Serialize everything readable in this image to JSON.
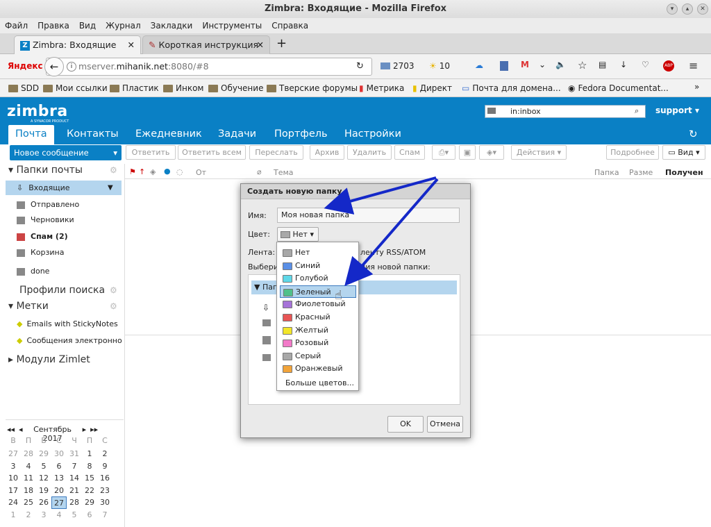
{
  "window": {
    "title": "Zimbra: Входящие - Mozilla Firefox"
  },
  "menubar": [
    "Файл",
    "Правка",
    "Вид",
    "Журнал",
    "Закладки",
    "Инструменты",
    "Справка"
  ],
  "tabs": [
    {
      "label": "Zimbra: Входящие"
    },
    {
      "label": "Короткая инструкция"
    }
  ],
  "navbar": {
    "search_engine": "Яндекс",
    "url_prefix": "mserver.",
    "url_domain": "mihanik.net",
    "url_suffix": ":8080/#8",
    "mail_count": "2703",
    "weather": "10"
  },
  "bookmarks": [
    "SDD",
    "Мои ссылки",
    "Пластик",
    "Инком",
    "Обучение",
    "Тверские форумы",
    "Метрика",
    "Директ",
    "Почта для домена...",
    "Fedora Documentat..."
  ],
  "zimbra": {
    "logo": "zimbra",
    "logo_sub": "A SYNACOR PRODUCT",
    "search_value": "in:inbox",
    "user": "support",
    "app_tabs": [
      "Почта",
      "Контакты",
      "Ежедневник",
      "Задачи",
      "Портфель",
      "Настройки"
    ],
    "new_message": "Новое сообщение",
    "toolbar": [
      "Ответить",
      "Ответить всем",
      "Переслать",
      "Архив",
      "Удалить",
      "Спам",
      "Действия",
      "Подробнее",
      "Вид"
    ],
    "list_columns": [
      "От",
      "Тема",
      "Папка",
      "Разме",
      "Получен"
    ]
  },
  "sidebar": {
    "mail_folders_title": "Папки почты",
    "folders": [
      {
        "label": "Входящие"
      },
      {
        "label": "Отправлено"
      },
      {
        "label": "Черновики"
      },
      {
        "label": "Спам (2)"
      },
      {
        "label": "Корзина"
      },
      {
        "label": "done"
      }
    ],
    "search_profiles": "Профили поиска",
    "tags_title": "Метки",
    "tags": [
      "Emails with StickyNotes",
      "Сообщения электронно"
    ],
    "zimlets": "Модули Zimlet"
  },
  "calendar": {
    "month": "Сентябрь 2017",
    "weekdays": [
      "В",
      "П",
      "В",
      "С",
      "Ч",
      "П",
      "С"
    ],
    "weeks": [
      [
        "27",
        "28",
        "29",
        "30",
        "31",
        "1",
        "2"
      ],
      [
        "3",
        "4",
        "5",
        "6",
        "7",
        "8",
        "9"
      ],
      [
        "10",
        "11",
        "12",
        "13",
        "14",
        "15",
        "16"
      ],
      [
        "17",
        "18",
        "19",
        "20",
        "21",
        "22",
        "23"
      ],
      [
        "24",
        "25",
        "26",
        "27",
        "28",
        "29",
        "30"
      ],
      [
        "1",
        "2",
        "3",
        "4",
        "5",
        "6",
        "7"
      ]
    ],
    "today": "27"
  },
  "dialog": {
    "title": "Создать новую папку",
    "name_label": "Имя:",
    "name_value": "Моя новая папка",
    "color_label": "Цвет:",
    "color_value": "Нет",
    "feed_label": "Лента:",
    "feed_text": "ленту RSS/ATOM",
    "select_label": "Выбери",
    "select_text": "ния новой папки:",
    "tree_root": "Пап",
    "ok": "OK",
    "cancel": "Отмена"
  },
  "color_menu": {
    "items": [
      {
        "label": "Нет",
        "color": "#a8a8a8"
      },
      {
        "label": "Синий",
        "color": "#5a8fe6"
      },
      {
        "label": "Голубой",
        "color": "#5fd8e8"
      },
      {
        "label": "Зеленый",
        "color": "#4fc08a"
      },
      {
        "label": "Фиолетовый",
        "color": "#a673d8"
      },
      {
        "label": "Красный",
        "color": "#e85555"
      },
      {
        "label": "Желтый",
        "color": "#f2e62a"
      },
      {
        "label": "Розовый",
        "color": "#f27ac8"
      },
      {
        "label": "Серый",
        "color": "#a8a8a8"
      },
      {
        "label": "Оранжевый",
        "color": "#f2a43a"
      }
    ],
    "more": "Больше цветов...",
    "highlighted": "Зеленый"
  },
  "colors": {
    "accent": "#0a80c5",
    "selection": "#b4d5ee",
    "annotation_arrow": "#1428c8"
  }
}
